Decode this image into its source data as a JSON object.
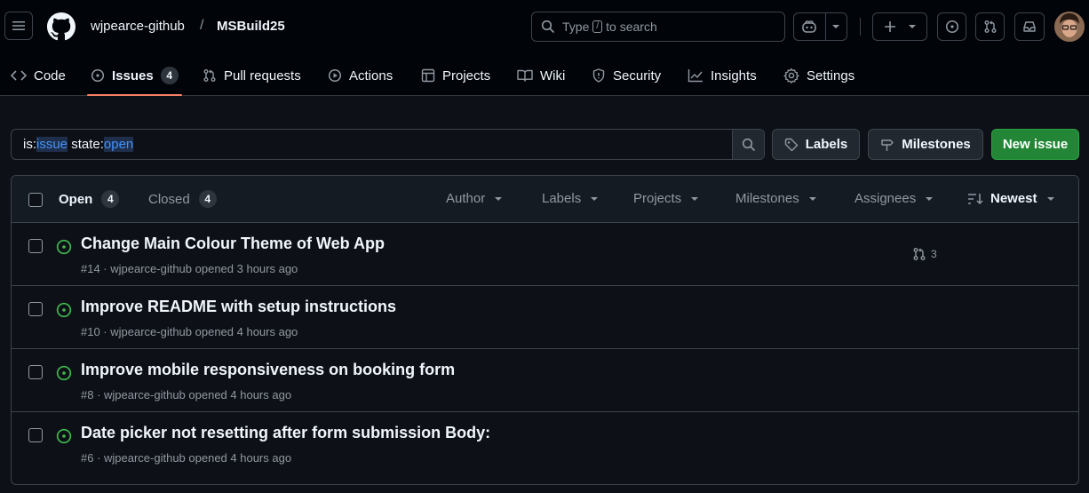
{
  "header": {
    "owner": "wjpearce-github",
    "separator": "/",
    "repo": "MSBuild25",
    "search": {
      "prefix": "Type",
      "key": "/",
      "suffix": "to search"
    }
  },
  "tabs": [
    {
      "label": "Code",
      "icon": "code-icon"
    },
    {
      "label": "Issues",
      "icon": "issue-opened-icon",
      "count": "4",
      "selected": true
    },
    {
      "label": "Pull requests",
      "icon": "git-pull-request-icon"
    },
    {
      "label": "Actions",
      "icon": "play-icon"
    },
    {
      "label": "Projects",
      "icon": "table-icon"
    },
    {
      "label": "Wiki",
      "icon": "book-icon"
    },
    {
      "label": "Security",
      "icon": "shield-icon"
    },
    {
      "label": "Insights",
      "icon": "graph-icon"
    },
    {
      "label": "Settings",
      "icon": "gear-icon"
    }
  ],
  "filter": {
    "k1": "is:",
    "v1": "issue",
    "k2": " state:",
    "v2": "open"
  },
  "actions": {
    "labels": "Labels",
    "milestones": "Milestones",
    "new_issue": "New issue"
  },
  "list_header": {
    "open_label": "Open",
    "open_count": "4",
    "closed_label": "Closed",
    "closed_count": "4",
    "author": "Author",
    "labels": "Labels",
    "projects": "Projects",
    "milestones": "Milestones",
    "assignees": "Assignees",
    "sort": "Newest"
  },
  "issues": [
    {
      "title": "Change Main Colour Theme of Web App",
      "meta": "#14 · wjpearce-github opened 3 hours ago",
      "linked_prs": "3"
    },
    {
      "title": "Improve README with setup instructions",
      "meta": "#10 · wjpearce-github opened 4 hours ago"
    },
    {
      "title": "Improve mobile responsiveness on booking form",
      "meta": "#8 · wjpearce-github opened 4 hours ago"
    },
    {
      "title": "Date picker not resetting after form submission Body:",
      "meta": "#6 · wjpearce-github opened 4 hours ago"
    }
  ],
  "colors": {
    "bg": "#0d1117",
    "header_bg": "#010409",
    "accent_underline": "#f78166",
    "open_icon": "#3fb950",
    "new_issue_button": "#238636",
    "filter_token": "#4493f8"
  }
}
